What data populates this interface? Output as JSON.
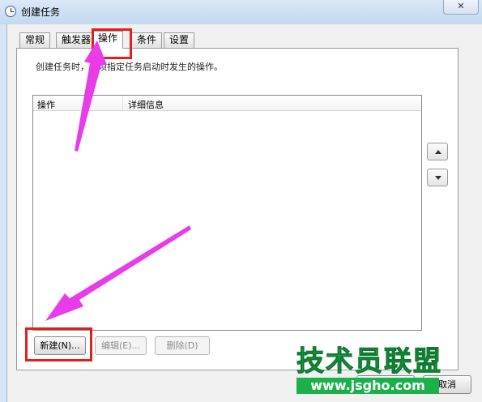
{
  "window": {
    "title": "创建任务",
    "close_glyph": "✕"
  },
  "tabs": [
    {
      "label": "常规"
    },
    {
      "label": "触发器"
    },
    {
      "label": "操作"
    },
    {
      "label": "条件"
    },
    {
      "label": "设置"
    }
  ],
  "active_tab": "操作",
  "panel": {
    "description": "创建任务时，必须指定任务启动时发生的操作。"
  },
  "list": {
    "columns": [
      "操作",
      "详细信息"
    ],
    "rows": []
  },
  "buttons": {
    "new": "新建(N)...",
    "edit": "编辑(E)...",
    "delete": "删除(D)",
    "ok": "",
    "cancel": "取消"
  },
  "watermark": {
    "title": "技术员联盟",
    "url": "www.jsgho.com"
  },
  "colors": {
    "highlight": "#e0201b",
    "arrow": "#e83ce8",
    "watermark": "#1bb14a"
  }
}
